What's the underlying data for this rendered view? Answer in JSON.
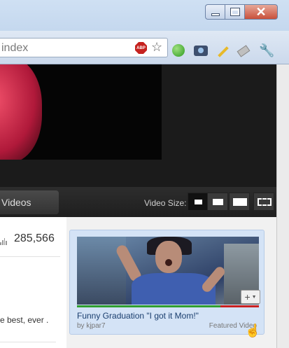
{
  "window": {
    "minimize_label": "",
    "maximize_label": "",
    "close_label": "✕"
  },
  "toolbar": {
    "url_text": "index",
    "abp_label": "ABP",
    "star_icon": "star-icon",
    "wrench_icon": "wrench-icon"
  },
  "player": {
    "videos_label": "Videos",
    "video_size_label": "Video Size:"
  },
  "info": {
    "view_count": "285,566",
    "description_snippet": "e best, ever ."
  },
  "featured": {
    "title": "Funny Graduation \"I got it Mom!\"",
    "author": "by kjpar7",
    "label": "Featured Video",
    "add_label": "+",
    "rating_likes_fraction": 0.79
  },
  "colors": {
    "accent_link": "#1a3e6e",
    "rating_good": "#2f9e2f",
    "rating_bad": "#c92020"
  }
}
